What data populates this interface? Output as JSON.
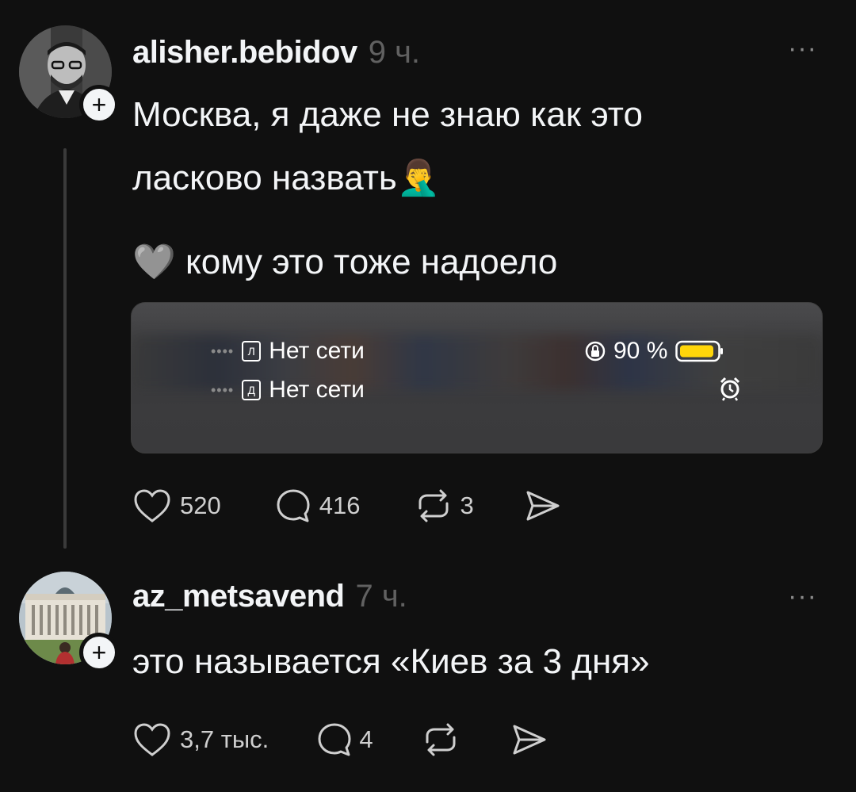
{
  "posts": [
    {
      "username": "alisher.bebidov",
      "time": "9 ч.",
      "text_line1": "Москва, я даже не знаю как это",
      "text_line2": "ласково назвать🤦‍♂️",
      "text_line3": "🩶 кому это тоже надоело",
      "preview": {
        "sim1_label": "Л",
        "sim1_text": "Нет сети",
        "sim2_label": "Д",
        "sim2_text": "Нет сети",
        "battery": "90 %"
      },
      "likes": "520",
      "comments": "416",
      "reposts": "3"
    },
    {
      "username": "az_metsavend",
      "time": "7 ч.",
      "text_line1": "это называется «Киев за 3 дня»",
      "likes": "3,7 тыс.",
      "comments": "4"
    }
  ],
  "more_label": "···",
  "follow_label": "+",
  "colors": {
    "background": "#101010",
    "text": "#f3f5f7",
    "muted": "#616161",
    "battery": "#ffd60a"
  }
}
